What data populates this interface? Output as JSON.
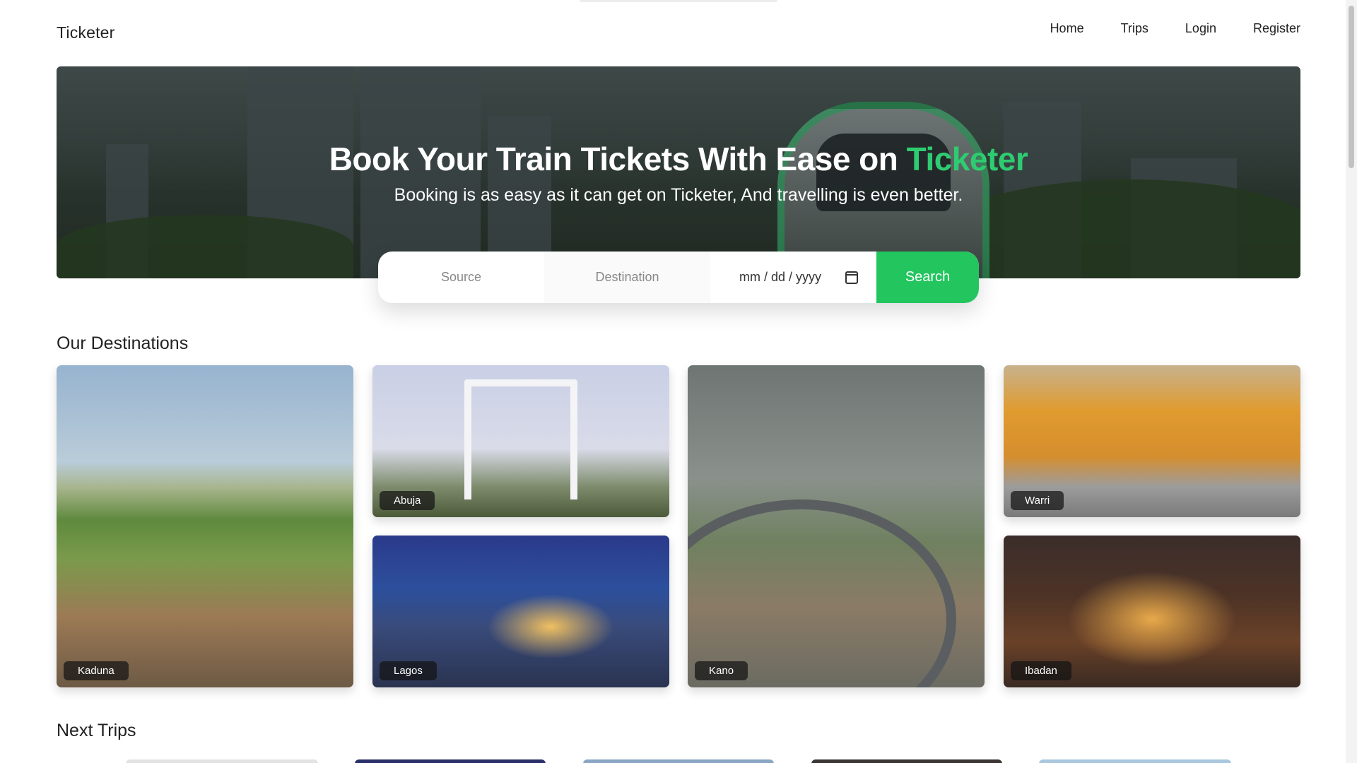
{
  "nav": {
    "brand": "Ticketer",
    "links": [
      "Home",
      "Trips",
      "Login",
      "Register"
    ]
  },
  "hero": {
    "title_prefix": "Book Your Train Tickets With Ease on ",
    "title_accent": "Ticketer",
    "subtitle": "Booking is as easy as it can get on Ticketer, And travelling is even better."
  },
  "search": {
    "source_placeholder": "Source",
    "destination_placeholder": "Destination",
    "date_placeholder": "mm / dd / yyyy",
    "button_label": "Search",
    "icon": "calendar-icon"
  },
  "destinations": {
    "title": "Our Destinations",
    "cards": [
      "Kaduna",
      "Abuja",
      "Lagos",
      "Kano",
      "Warri",
      "Ibadan"
    ]
  },
  "next_trips": {
    "title": "Next Trips"
  },
  "colors": {
    "accent": "#22c55e",
    "accent_text": "#2ecc71"
  }
}
